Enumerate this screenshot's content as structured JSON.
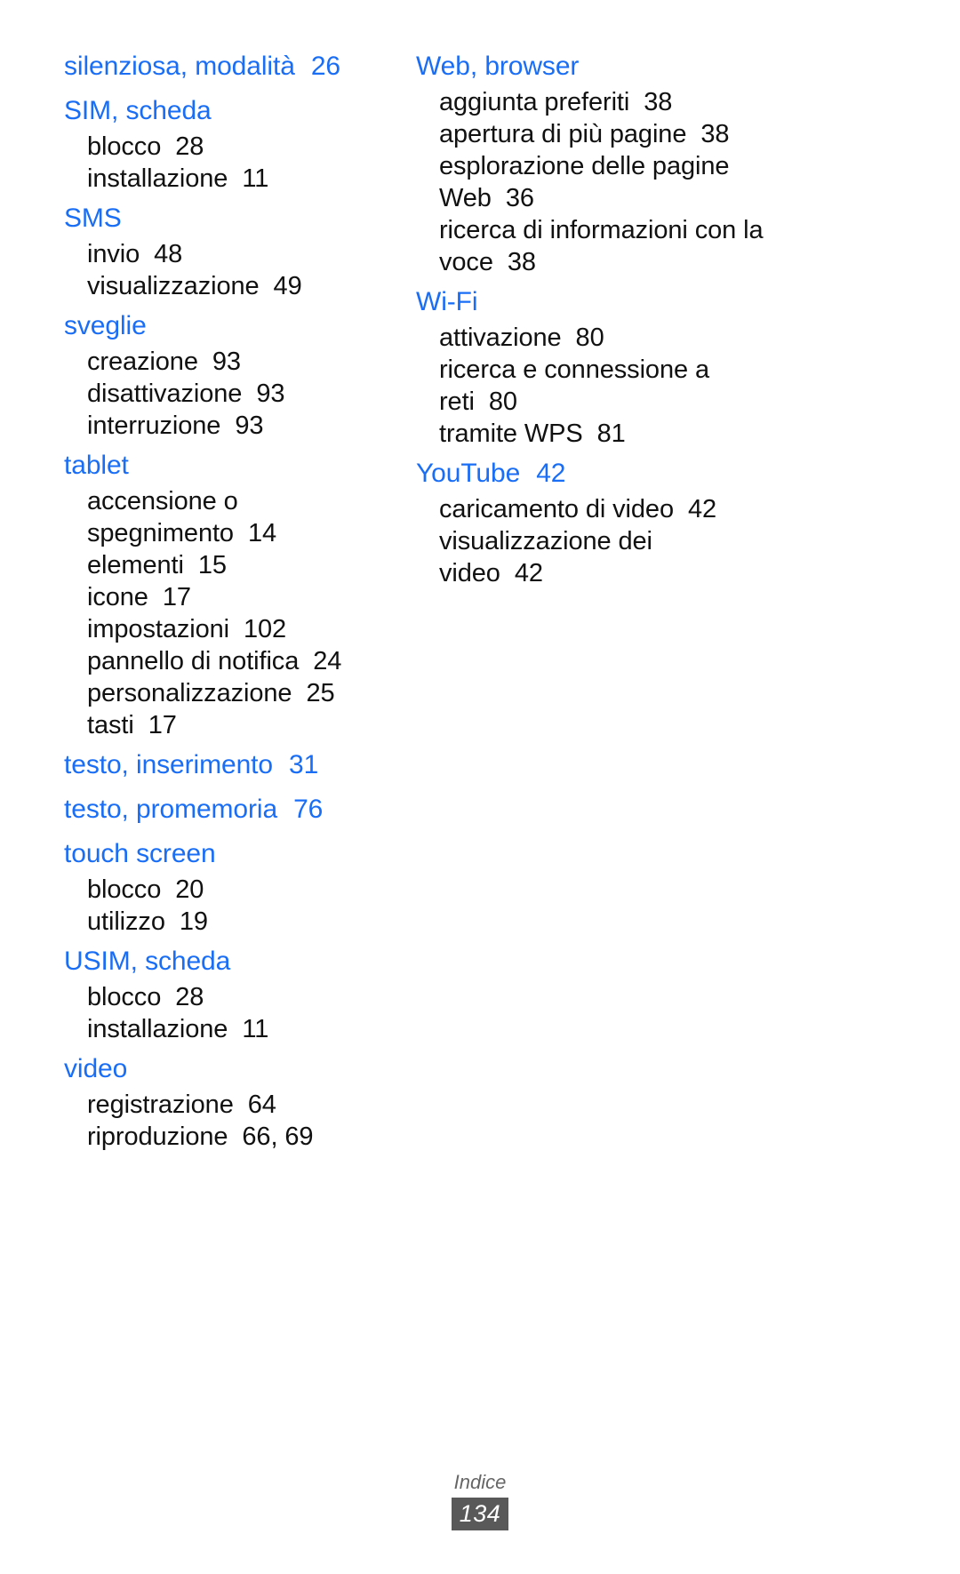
{
  "document": {
    "type": "index-page",
    "language": "it",
    "accent_color": "#1a6ef5",
    "text_color": "#111111"
  },
  "columns": [
    {
      "id": "left",
      "groups": [
        {
          "heading": "silenziosa, modalità",
          "heading_page": "26",
          "subentries": []
        },
        {
          "heading": "SIM, scheda",
          "heading_page": "",
          "subentries": [
            {
              "label": "blocco",
              "page": "28"
            },
            {
              "label": "installazione",
              "page": "11"
            }
          ]
        },
        {
          "heading": "SMS",
          "heading_page": "",
          "subentries": [
            {
              "label": "invio",
              "page": "48"
            },
            {
              "label": "visualizzazione",
              "page": "49"
            }
          ]
        },
        {
          "heading": "sveglie",
          "heading_page": "",
          "subentries": [
            {
              "label": "creazione",
              "page": "93"
            },
            {
              "label": "disattivazione",
              "page": "93"
            },
            {
              "label": "interruzione",
              "page": "93"
            }
          ]
        },
        {
          "heading": "tablet",
          "heading_page": "",
          "subentries": [
            {
              "label": "accensione o",
              "page": ""
            },
            {
              "label": "spegnimento",
              "page": "14"
            },
            {
              "label": "elementi",
              "page": "15"
            },
            {
              "label": "icone",
              "page": "17"
            },
            {
              "label": "impostazioni",
              "page": "102"
            },
            {
              "label": "pannello di notifica",
              "page": "24"
            },
            {
              "label": "personalizzazione",
              "page": "25"
            },
            {
              "label": "tasti",
              "page": "17"
            }
          ]
        },
        {
          "heading": "testo, inserimento",
          "heading_page": "31",
          "subentries": []
        },
        {
          "heading": "testo, promemoria",
          "heading_page": "76",
          "subentries": []
        },
        {
          "heading": "touch screen",
          "heading_page": "",
          "subentries": [
            {
              "label": "blocco",
              "page": "20"
            },
            {
              "label": "utilizzo",
              "page": "19"
            }
          ]
        },
        {
          "heading": "USIM, scheda",
          "heading_page": "",
          "subentries": [
            {
              "label": "blocco",
              "page": "28"
            },
            {
              "label": "installazione",
              "page": "11"
            }
          ]
        },
        {
          "heading": "video",
          "heading_page": "",
          "subentries": [
            {
              "label": "registrazione",
              "page": "64"
            },
            {
              "label": "riproduzione",
              "page": "66, 69"
            }
          ]
        }
      ]
    },
    {
      "id": "right",
      "groups": [
        {
          "heading": "Web, browser",
          "heading_page": "",
          "subentries": [
            {
              "label": "aggiunta preferiti",
              "page": "38"
            },
            {
              "label": "apertura di più pagine",
              "page": "38"
            },
            {
              "label": "esplorazione delle pagine",
              "page": ""
            },
            {
              "label": "Web",
              "page": "36"
            },
            {
              "label": "ricerca di informazioni con la",
              "page": ""
            },
            {
              "label": "voce",
              "page": "38"
            }
          ]
        },
        {
          "heading": "Wi-Fi",
          "heading_page": "",
          "subentries": [
            {
              "label": "attivazione",
              "page": "80"
            },
            {
              "label": "ricerca e connessione a",
              "page": ""
            },
            {
              "label": "reti",
              "page": "80"
            },
            {
              "label": "tramite WPS",
              "page": "81"
            }
          ]
        },
        {
          "heading": "YouTube",
          "heading_page": "42",
          "subentries": [
            {
              "label": "caricamento di video",
              "page": "42"
            },
            {
              "label": "visualizzazione dei",
              "page": ""
            },
            {
              "label": "video",
              "page": "42"
            }
          ]
        }
      ]
    }
  ],
  "footer": {
    "label": "Indice",
    "page_number": "134"
  }
}
